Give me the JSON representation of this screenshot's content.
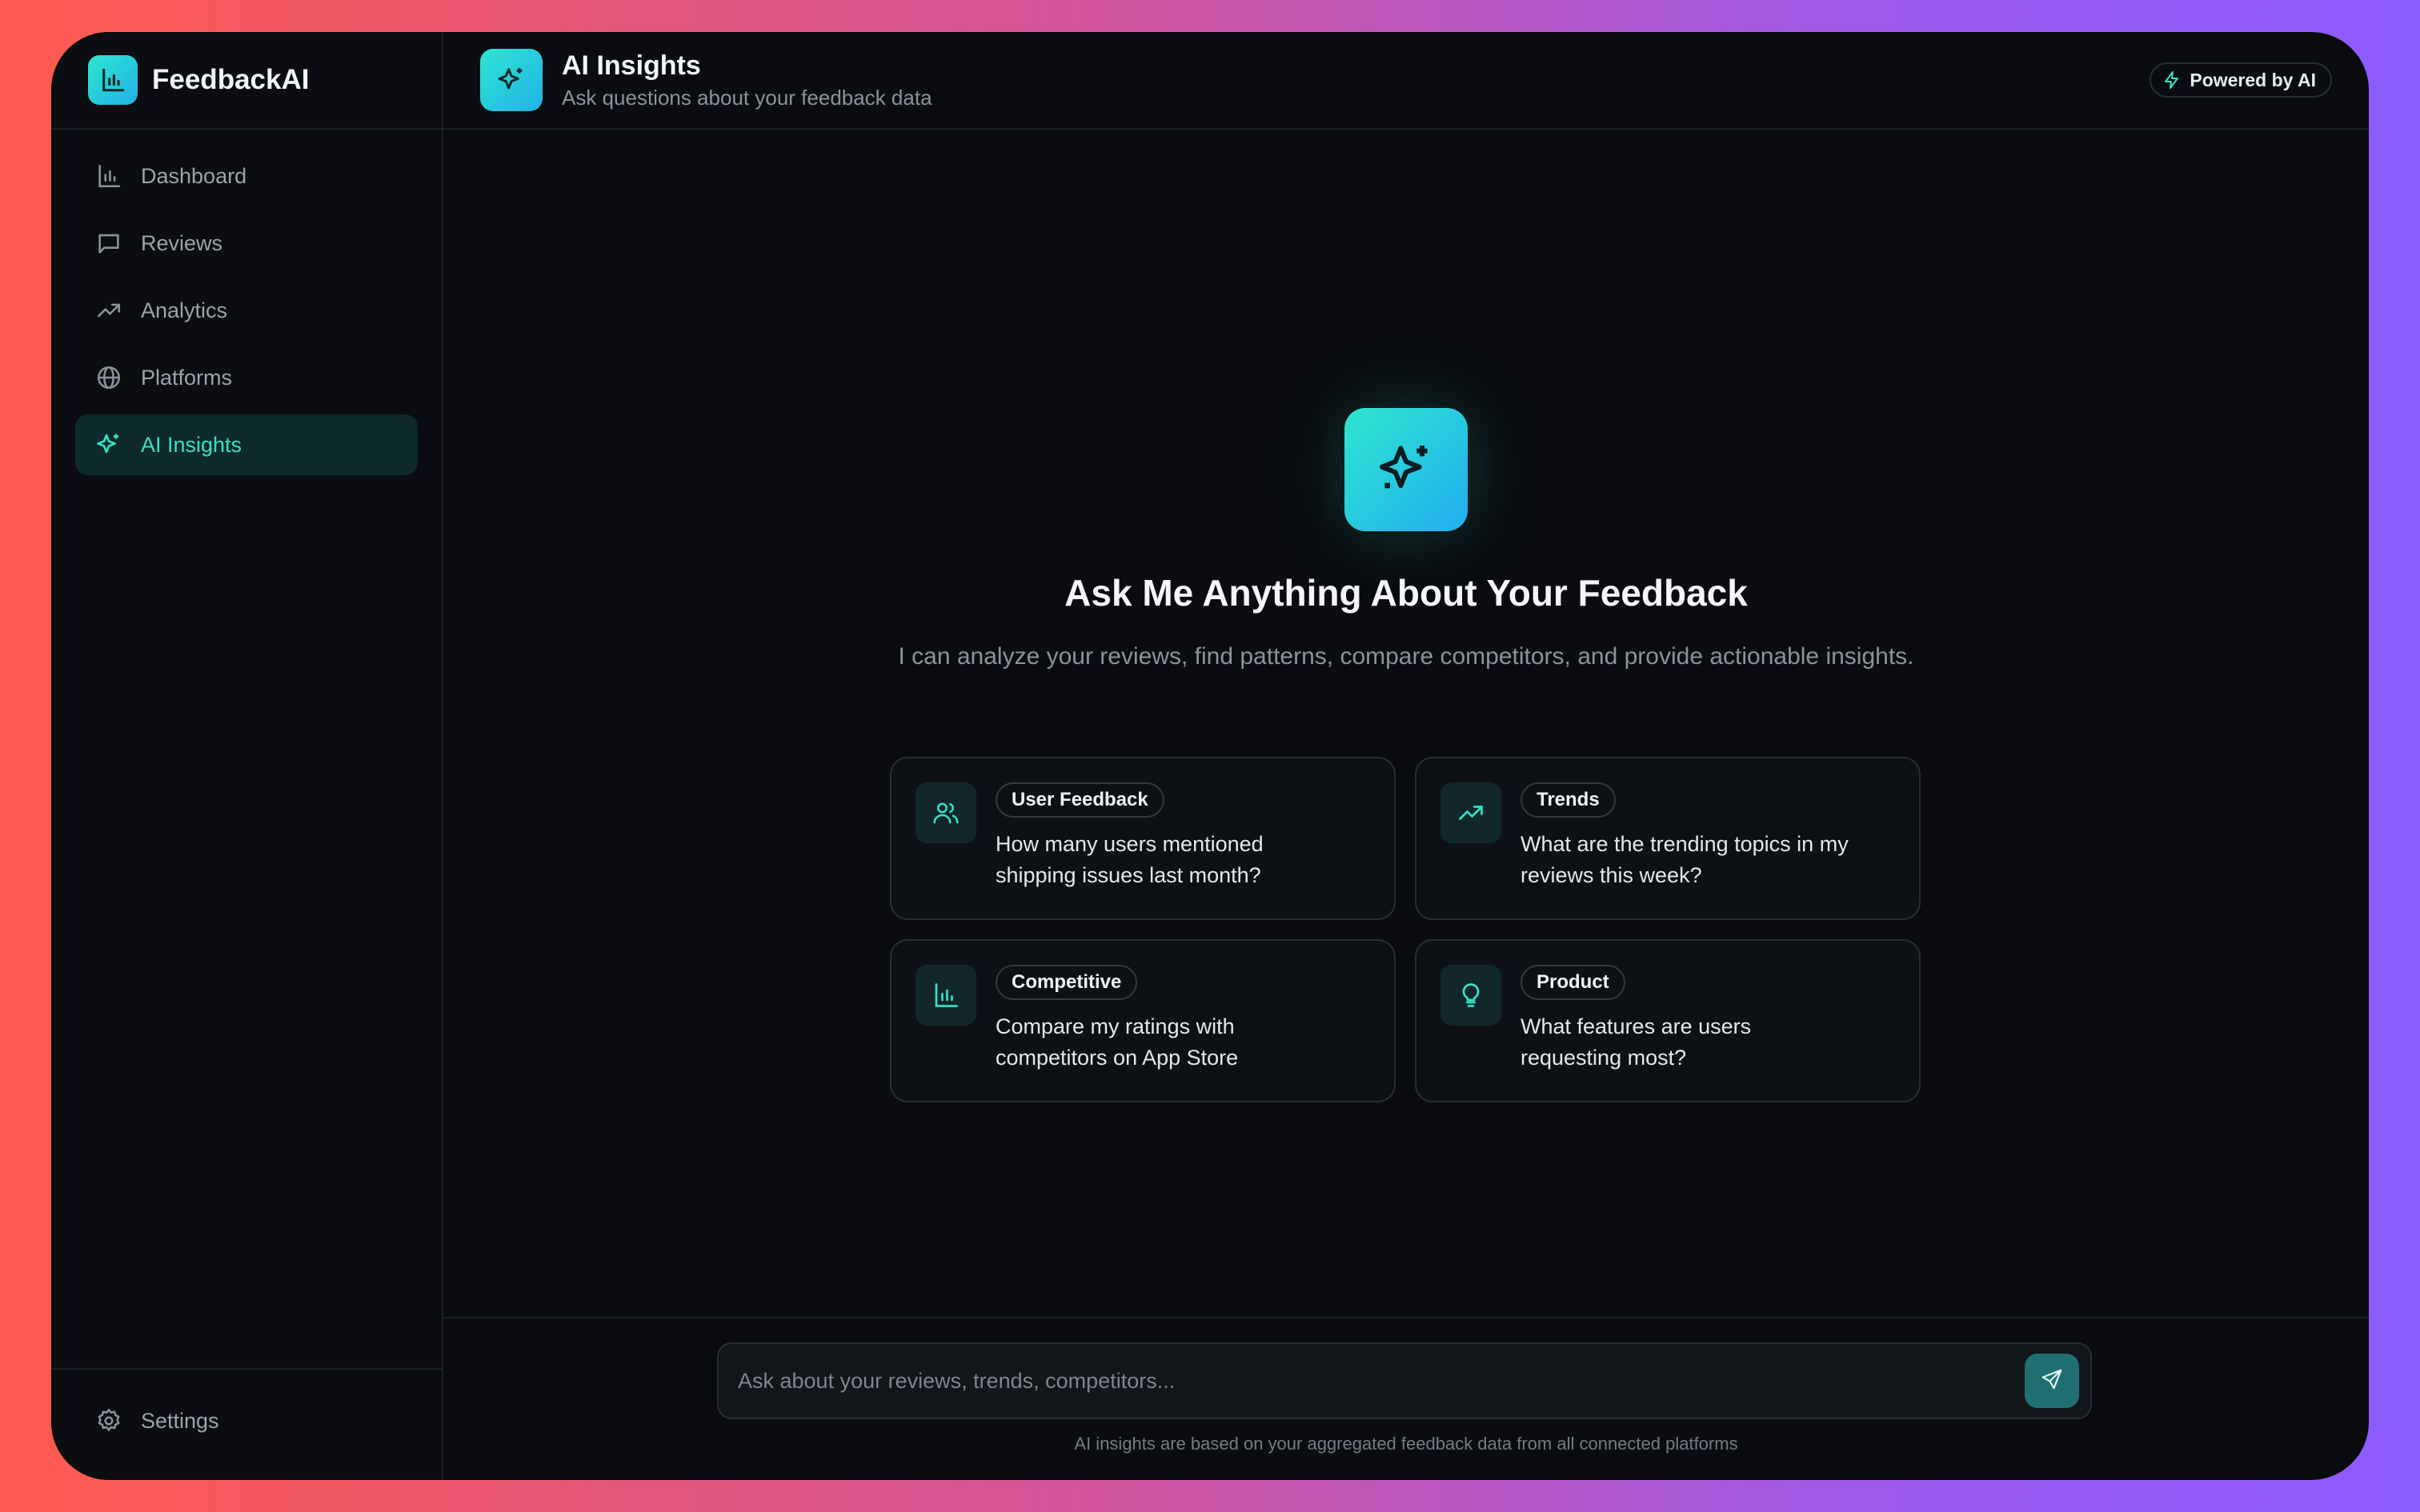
{
  "brand": {
    "name": "FeedbackAI",
    "icon": "bar-chart-icon"
  },
  "sidebar": {
    "items": [
      {
        "label": "Dashboard",
        "icon": "bar-chart-icon",
        "active": false
      },
      {
        "label": "Reviews",
        "icon": "message-square-icon",
        "active": false
      },
      {
        "label": "Analytics",
        "icon": "trending-up-icon",
        "active": false
      },
      {
        "label": "Platforms",
        "icon": "globe-icon",
        "active": false
      },
      {
        "label": "AI Insights",
        "icon": "sparkles-icon",
        "active": true
      }
    ],
    "footer": {
      "label": "Settings",
      "icon": "gear-icon"
    }
  },
  "header": {
    "title": "AI Insights",
    "subtitle": "Ask questions about your feedback data",
    "badge": "Powered by AI"
  },
  "hero": {
    "title": "Ask Me Anything About Your Feedback",
    "description": "I can analyze your reviews, find patterns, compare competitors, and provide actionable insights."
  },
  "suggestions": [
    {
      "tag": "User Feedback",
      "text": "How many users mentioned shipping issues last month?",
      "icon": "users-icon"
    },
    {
      "tag": "Trends",
      "text": "What are the trending topics in my reviews this week?",
      "icon": "trending-up-icon"
    },
    {
      "tag": "Competitive",
      "text": "Compare my ratings with competitors on App Store",
      "icon": "bar-chart-icon"
    },
    {
      "tag": "Product",
      "text": "What features are users requesting most?",
      "icon": "lightbulb-icon"
    }
  ],
  "chat": {
    "placeholder": "Ask about your reviews, trends, competitors...",
    "value": "",
    "disclaimer": "AI insights are based on your aggregated feedback data from all connected platforms"
  },
  "colors": {
    "accent": "#36e0c4",
    "background": "#0a0c0f",
    "active_bg": "#0e2a2a"
  }
}
